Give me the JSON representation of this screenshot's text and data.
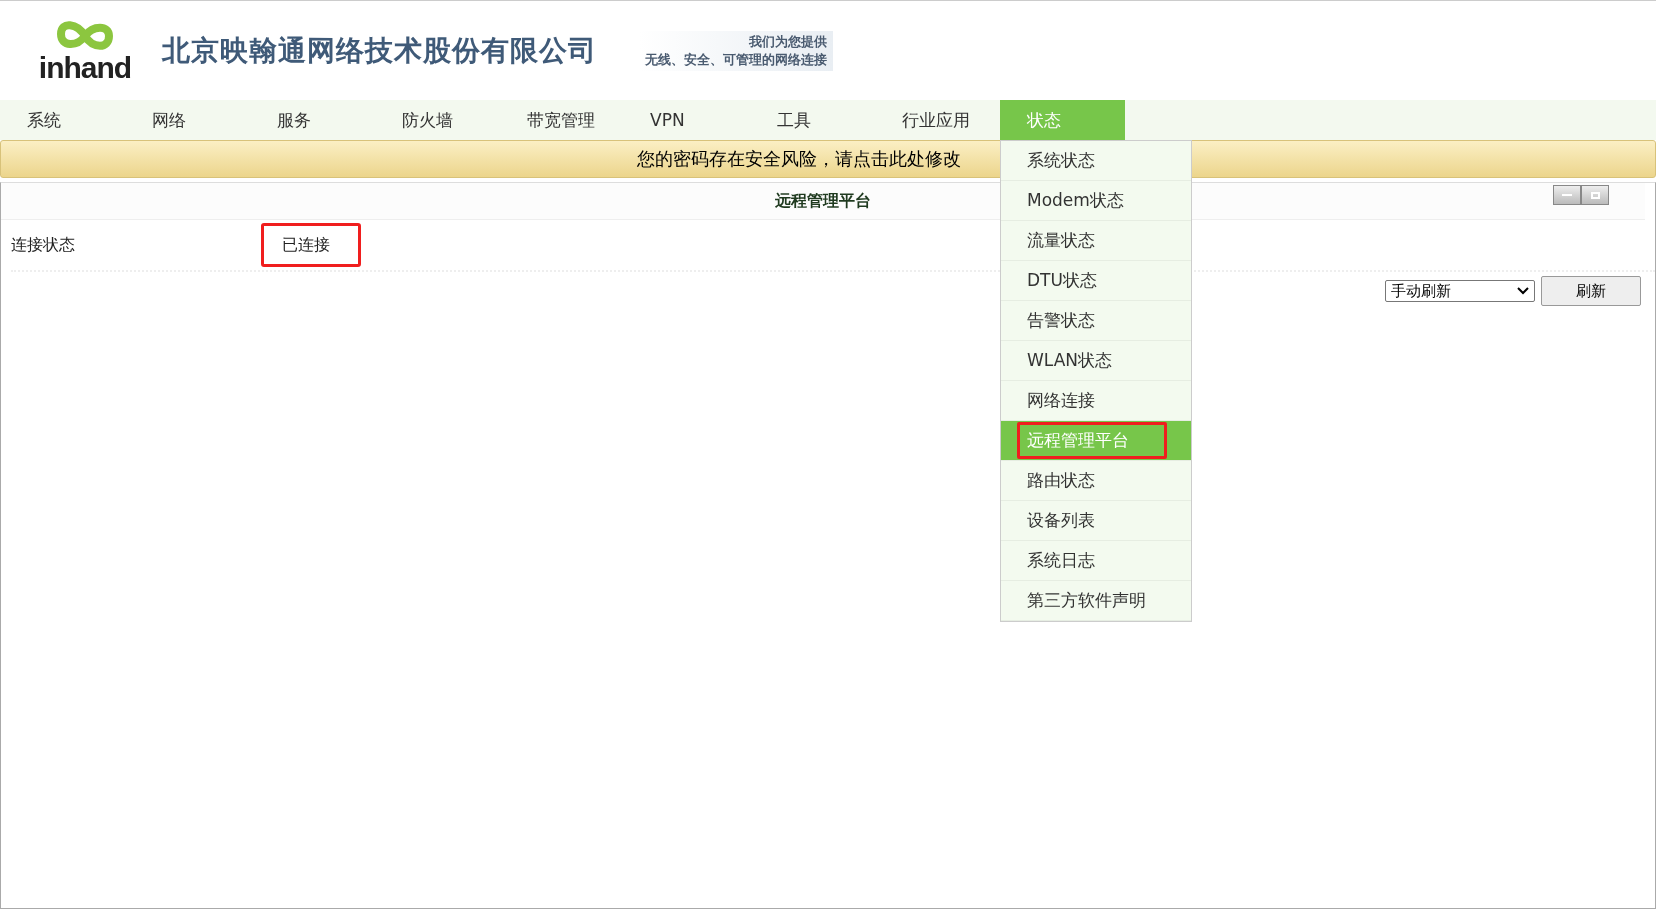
{
  "header": {
    "logo_text": "inhand",
    "company": "北京映翰通网络技术股份有限公司",
    "slogan": [
      "我们为您提供",
      "无线、安全、可管理的网络连接"
    ]
  },
  "nav": [
    {
      "label": "系统",
      "selected": false
    },
    {
      "label": "网络",
      "selected": false
    },
    {
      "label": "服务",
      "selected": false
    },
    {
      "label": "防火墙",
      "selected": false
    },
    {
      "label": "带宽管理",
      "selected": false
    },
    {
      "label": "VPN",
      "selected": false
    },
    {
      "label": "工具",
      "selected": false
    },
    {
      "label": "行业应用",
      "selected": false
    },
    {
      "label": "状态",
      "selected": true
    }
  ],
  "dropdown": [
    {
      "label": "系统状态",
      "selected": false,
      "highlighted": false
    },
    {
      "label": "Modem状态",
      "selected": false,
      "highlighted": false
    },
    {
      "label": "流量状态",
      "selected": false,
      "highlighted": false
    },
    {
      "label": "DTU状态",
      "selected": false,
      "highlighted": false
    },
    {
      "label": "告警状态",
      "selected": false,
      "highlighted": false
    },
    {
      "label": "WLAN状态",
      "selected": false,
      "highlighted": false
    },
    {
      "label": "网络连接",
      "selected": false,
      "highlighted": false
    },
    {
      "label": "远程管理平台",
      "selected": true,
      "highlighted": true
    },
    {
      "label": "路由状态",
      "selected": false,
      "highlighted": false
    },
    {
      "label": "设备列表",
      "selected": false,
      "highlighted": false
    },
    {
      "label": "系统日志",
      "selected": false,
      "highlighted": false
    },
    {
      "label": "第三方软件声明",
      "selected": false,
      "highlighted": false
    }
  ],
  "warning": "您的密码存在安全风险，请点击此处修改",
  "panel": {
    "title": "远程管理平台",
    "rows": [
      {
        "label": "连接状态",
        "value": "已连接",
        "highlighted": true
      }
    ],
    "refresh_mode": "手动刷新",
    "refresh_button": "刷新"
  }
}
